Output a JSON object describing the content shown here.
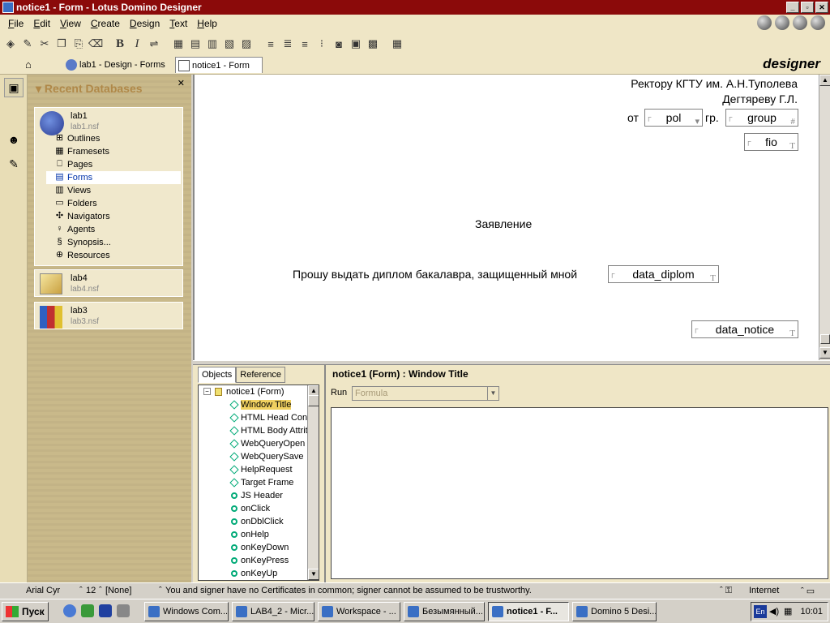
{
  "window": {
    "title": "notice1 - Form - Lotus Domino Designer"
  },
  "menu": [
    {
      "label": "File",
      "u": "F",
      "rest": "ile"
    },
    {
      "label": "Edit",
      "u": "E",
      "rest": "dit"
    },
    {
      "label": "View",
      "u": "V",
      "rest": "iew"
    },
    {
      "label": "Create",
      "u": "C",
      "rest": "reate"
    },
    {
      "label": "Design",
      "u": "D",
      "rest": "esign"
    },
    {
      "label": "Text",
      "u": "T",
      "rest": "ext"
    },
    {
      "label": "Help",
      "u": "H",
      "rest": "elp"
    }
  ],
  "toolbar": {
    "bold": "B",
    "italic": "I"
  },
  "tabs": {
    "home_icon": "home-icon",
    "tab1": "lab1 - Design - Forms",
    "tab2": "notice1 - Form",
    "tab2_close": "✕",
    "brand": "designer"
  },
  "nav": {
    "heading": "Recent Databases",
    "close": "✕",
    "databases": [
      {
        "name": "lab1",
        "file": "lab1.nsf"
      },
      {
        "name": "lab4",
        "file": "lab4.nsf"
      },
      {
        "name": "lab3",
        "file": "lab3.nsf"
      }
    ],
    "items": [
      "Outlines",
      "Framesets",
      "Pages",
      "Forms",
      "Views",
      "Folders",
      "Navigators",
      "Agents",
      "Synopsis...",
      "Resources"
    ],
    "selected_item": "Forms"
  },
  "doc": {
    "line1": "Ректору КГТУ им. А.Н.Туполева",
    "line2": "Дегтяреву Г.Л.",
    "from": "от",
    "group_prefix": "гр.",
    "field_pol": "pol",
    "field_group": "group",
    "field_fio": "fio",
    "heading": "Заявление",
    "request": "Прошу выдать диплом бакалавра, защищенный мной",
    "field_data_diplom": "data_diplom",
    "field_data_notice": "data_notice"
  },
  "objects": {
    "tab_objects": "Objects",
    "tab_reference": "Reference",
    "root": "notice1 (Form)",
    "events": [
      {
        "label": "Window Title",
        "kind": "diamond",
        "selected": true
      },
      {
        "label": "HTML Head Con",
        "kind": "diamond"
      },
      {
        "label": "HTML Body Attrit",
        "kind": "diamond"
      },
      {
        "label": "WebQueryOpen",
        "kind": "diamond"
      },
      {
        "label": "WebQuerySave",
        "kind": "diamond"
      },
      {
        "label": "HelpRequest",
        "kind": "diamond"
      },
      {
        "label": "Target Frame",
        "kind": "diamond"
      },
      {
        "label": "JS Header",
        "kind": "circle"
      },
      {
        "label": "onClick",
        "kind": "circle"
      },
      {
        "label": "onDblClick",
        "kind": "circle"
      },
      {
        "label": "onHelp",
        "kind": "circle"
      },
      {
        "label": "onKeyDown",
        "kind": "circle"
      },
      {
        "label": "onKeyPress",
        "kind": "circle"
      },
      {
        "label": "onKeyUp",
        "kind": "circle"
      }
    ]
  },
  "programmer": {
    "title": "notice1 (Form) : Window Title",
    "run_label": "Run",
    "run_value": "Formula"
  },
  "status": {
    "font": "Arial Cyr",
    "size": "12",
    "style": "[None]",
    "message": "You and signer have no Certificates in common; signer cannot be assumed to be trustworthy.",
    "location": "Internet"
  },
  "taskbar": {
    "start": "Пуск",
    "buttons": [
      "Windows Com...",
      "LAB4_2 - Micr...",
      "Workspace - ...",
      "Безымянный...",
      "notice1 - F...",
      "Domino 5 Desi..."
    ],
    "active_index": 4,
    "lang": "En",
    "time": "10:01"
  },
  "colors": {
    "titlebar": "#8b0a0a",
    "nav_bg": "#c9b98a",
    "selection": "#f0d060"
  }
}
